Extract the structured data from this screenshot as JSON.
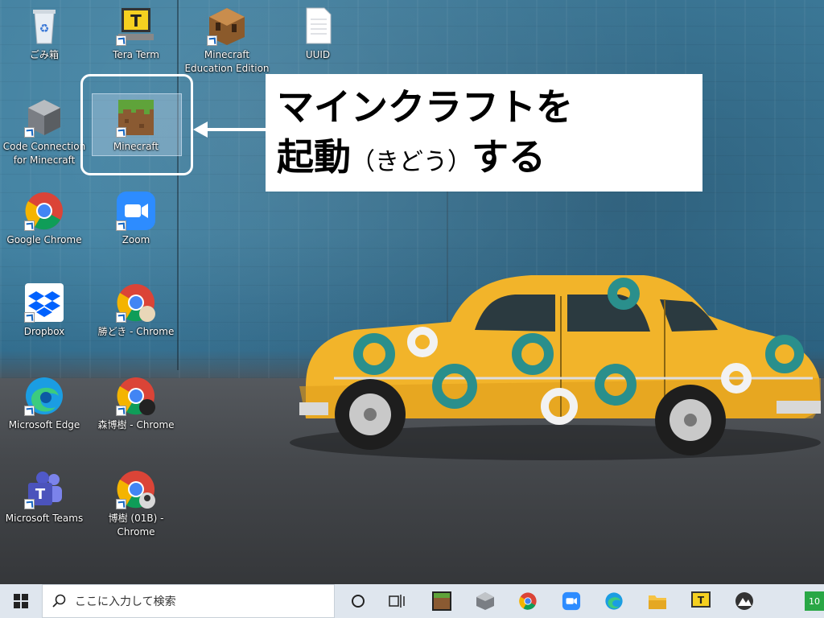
{
  "desktop": {
    "icons": [
      {
        "label": "ごみ箱"
      },
      {
        "label": "Tera Term"
      },
      {
        "label": "Minecraft Education Edition"
      },
      {
        "label": "UUID"
      },
      {
        "label": "Code Connection for Minecraft"
      },
      {
        "label": "Minecraft"
      },
      {
        "label": "Google Chrome"
      },
      {
        "label": "Zoom"
      },
      {
        "label": "Dropbox"
      },
      {
        "label": "勝どき - Chrome"
      },
      {
        "label": "Microsoft Edge"
      },
      {
        "label": "森博樹 - Chrome"
      },
      {
        "label": "Microsoft Teams"
      },
      {
        "label": "博樹 (01B) - Chrome"
      }
    ]
  },
  "callout": {
    "line1": "マインクラフトを",
    "line2_main": "起動",
    "line2_reading": "（きどう）",
    "line2_end": "する"
  },
  "taskbar": {
    "search_placeholder": "ここに入力して検索",
    "clock_text": "10",
    "apps": [
      "start-icon",
      "cortana-icon",
      "task-view-icon",
      "minecraft-icon",
      "code-connection-icon",
      "chrome-icon",
      "zoom-icon",
      "edge-icon",
      "file-explorer-icon",
      "tera-term-icon",
      "unknown-app-icon"
    ]
  },
  "colors": {
    "taskbar_bg": "#dfe6ee",
    "car_yellow": "#f2b42a",
    "car_teal": "#2a8f8c",
    "wall_blue": "#3d7fa0"
  }
}
